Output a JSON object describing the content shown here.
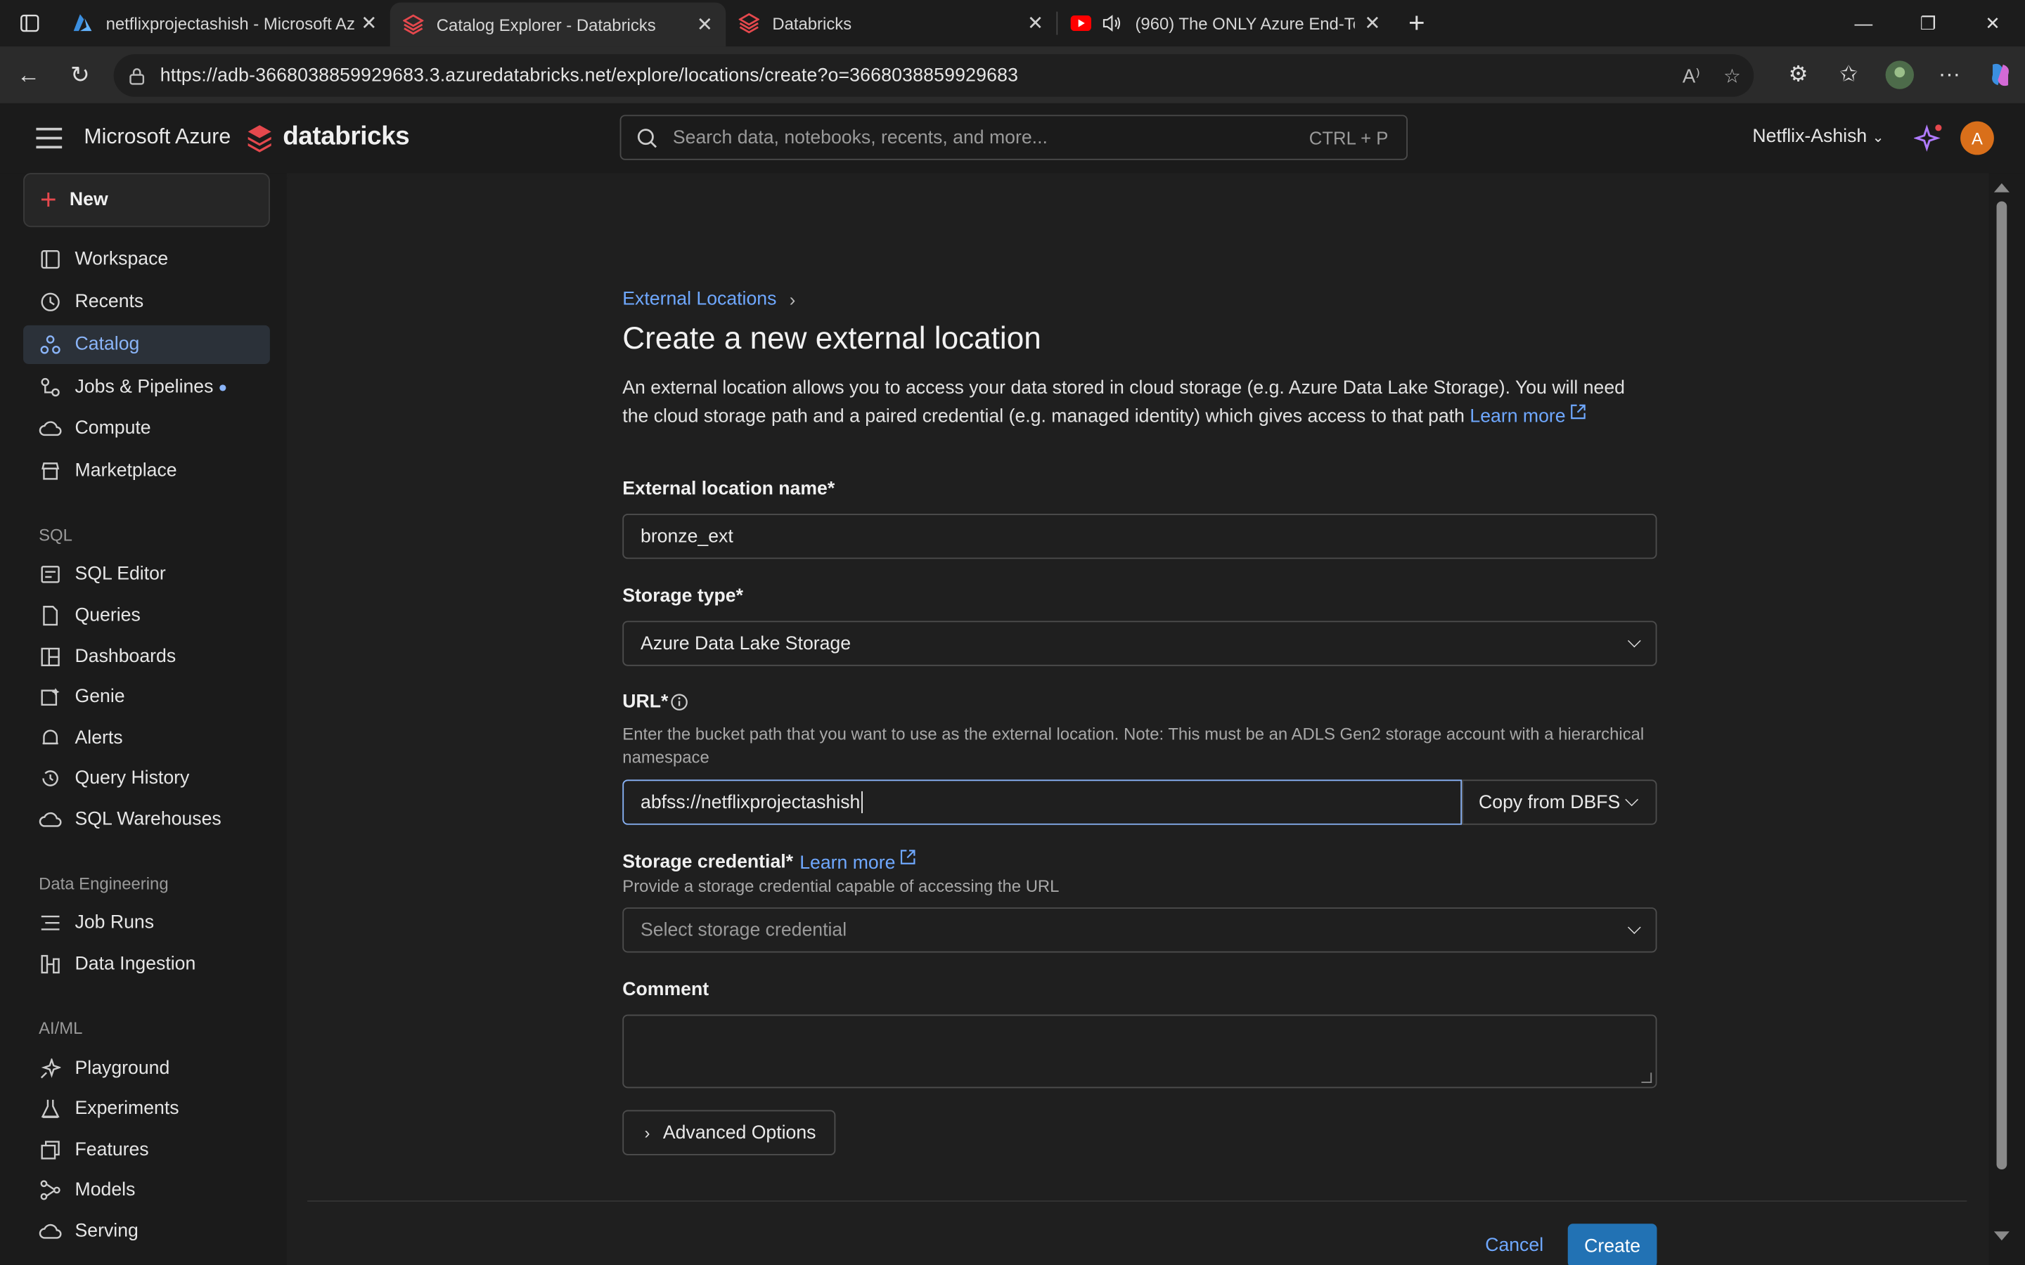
{
  "browser": {
    "tabs": [
      {
        "label": "netflixprojectashish - Microsoft Az",
        "icon": "azure-icon"
      },
      {
        "label": "Catalog Explorer - Databricks",
        "icon": "databricks-icon",
        "active": true
      },
      {
        "label": "Databricks",
        "icon": "databricks-icon"
      },
      {
        "label": "(960) The ONLY Azure End-To",
        "icon": "youtube-icon"
      }
    ],
    "url": "https://adb-3668038859929683.3.azuredatabricks.net/explore/locations/create?o=3668038859929683"
  },
  "header": {
    "brand": "Microsoft Azure",
    "product": "databricks",
    "search_placeholder": "Search data, notebooks, recents, and more...",
    "search_shortcut": "CTRL + P",
    "workspace": "Netflix-Ashish",
    "avatar_initial": "A"
  },
  "sidebar": {
    "new_label": "New",
    "items": [
      {
        "label": "Workspace",
        "icon": "workspace-icon"
      },
      {
        "label": "Recents",
        "icon": "clock-icon"
      },
      {
        "label": "Catalog",
        "icon": "catalog-icon",
        "active": true
      },
      {
        "label": "Jobs & Pipelines",
        "icon": "workflow-icon"
      },
      {
        "label": "Compute",
        "icon": "cloud-icon"
      },
      {
        "label": "Marketplace",
        "icon": "store-icon"
      }
    ],
    "sql_heading": "SQL",
    "sql_items": [
      {
        "label": "SQL Editor"
      },
      {
        "label": "Queries"
      },
      {
        "label": "Dashboards"
      },
      {
        "label": "Genie"
      },
      {
        "label": "Alerts"
      },
      {
        "label": "Query History"
      },
      {
        "label": "SQL Warehouses"
      }
    ],
    "de_heading": "Data Engineering",
    "de_items": [
      {
        "label": "Job Runs"
      },
      {
        "label": "Data Ingestion"
      }
    ],
    "ai_heading": "AI/ML",
    "ai_items": [
      {
        "label": "Playground"
      },
      {
        "label": "Experiments"
      },
      {
        "label": "Features"
      },
      {
        "label": "Models"
      },
      {
        "label": "Serving"
      }
    ]
  },
  "page": {
    "breadcrumb": "External Locations",
    "title": "Create a new external location",
    "description": "An external location allows you to access your data stored in cloud storage (e.g. Azure Data Lake Storage). You will need the cloud storage path and a paired credential (e.g. managed identity) which gives access to that path",
    "learn_more": "Learn more",
    "name_label": "External location name*",
    "name_value": "bronze_ext",
    "storage_type_label": "Storage type*",
    "storage_type_value": "Azure Data Lake Storage",
    "url_label": "URL*",
    "url_help": "Enter the bucket path that you want to use as the external location. Note: This must be an ADLS Gen2 storage account with a hierarchical namespace",
    "url_value": "abfss://netflixprojectashish",
    "copy_from": "Copy from DBFS",
    "credential_label": "Storage credential*",
    "credential_learn_more": "Learn more",
    "credential_help": "Provide a storage credential capable of accessing the URL",
    "credential_placeholder": "Select storage credential",
    "comment_label": "Comment",
    "advanced_label": "Advanced Options",
    "cancel_label": "Cancel",
    "create_label": "Create"
  }
}
